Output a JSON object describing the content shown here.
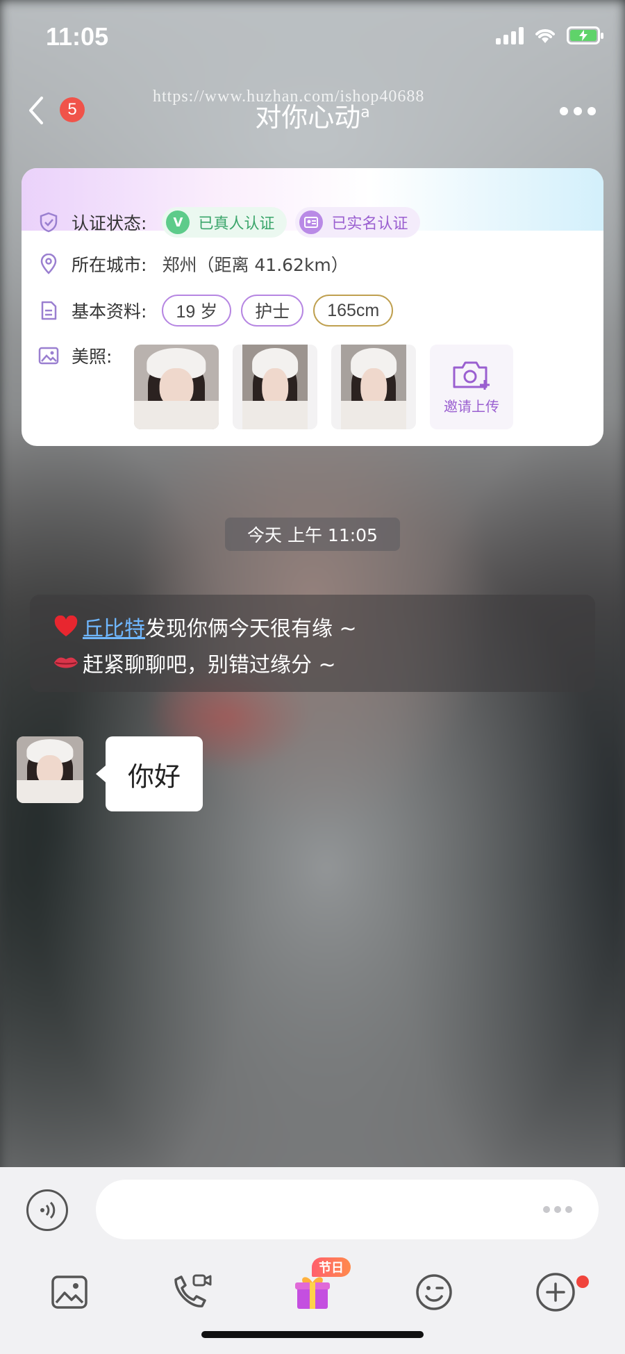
{
  "status_bar": {
    "time": "11:05"
  },
  "nav": {
    "unread_count": "5",
    "title": "对你心动",
    "title_superscript": "a",
    "watermark": "https://www.huzhan.com/ishop40688"
  },
  "profile_card": {
    "verify": {
      "label": "认证状态:",
      "badges": [
        {
          "text": "已真人认证",
          "color": "#3aa56a"
        },
        {
          "text": "已实名认证",
          "color": "#9a5fd0"
        }
      ]
    },
    "city": {
      "label": "所在城市:",
      "value": "郑州（距离 41.62km）"
    },
    "basic": {
      "label": "基本资料:",
      "tags": [
        "19 岁",
        "护士",
        "165cm"
      ]
    },
    "photos": {
      "label": "美照:",
      "invite_label": "邀请上传"
    }
  },
  "chat": {
    "timestamp": "今天 上午 11:05",
    "system_message": {
      "line1_link": "丘比特",
      "line1_rest": "发现你俩今天很有缘 ~",
      "line2": "赶紧聊聊吧，别错过缘分 ~"
    },
    "messages": [
      {
        "sender": "other",
        "text": "你好"
      }
    ]
  },
  "input": {
    "value": "",
    "holiday_badge": "节日"
  },
  "colors": {
    "accent_purple": "#9a5fd0",
    "verify_green": "#3aa56a",
    "badge_red": "#f0534a",
    "link_blue": "#6fb7ff"
  },
  "icons": {
    "row_verify": "shield-check-icon",
    "row_city": "location-pin-icon",
    "row_basic": "document-icon",
    "row_photos": "image-icon",
    "toolbar": [
      "image-icon",
      "video-call-icon",
      "gift-icon",
      "emoji-icon",
      "plus-icon"
    ]
  }
}
